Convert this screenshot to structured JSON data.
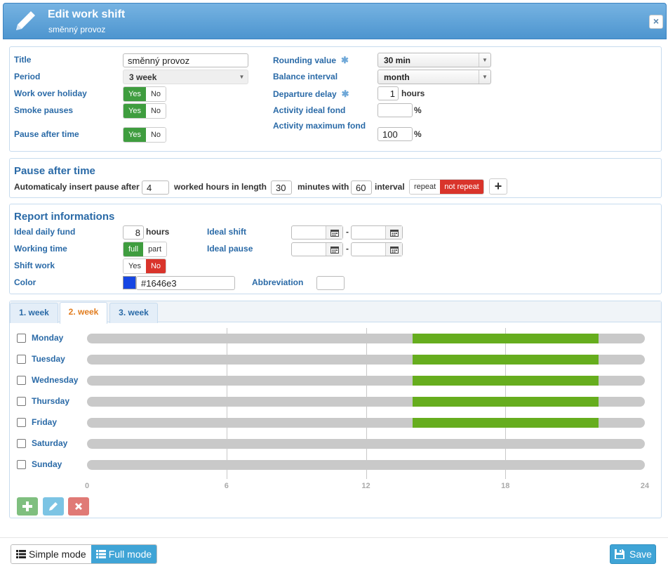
{
  "header": {
    "title": "Edit work shift",
    "subtitle": "směnný provoz",
    "close_label": "×"
  },
  "general": {
    "title_label": "Title",
    "title_value": "směnný provoz",
    "period_label": "Period",
    "period_value": "3 week",
    "holiday_label": "Work over holiday",
    "smoke_label": "Smoke pauses",
    "pause_after_time_label": "Pause after time",
    "yes": "Yes",
    "no": "No",
    "rounding_label": "Rounding value",
    "rounding_value": "30 min",
    "balance_label": "Balance interval",
    "balance_value": "month",
    "departure_label": "Departure delay",
    "departure_value": "1",
    "departure_unit": "hours",
    "ideal_fond_label": "Activity ideal fond",
    "ideal_fond_value": "",
    "max_fond_label": "Activity maximum fond",
    "max_fond_value": "100",
    "percent": "%"
  },
  "pause": {
    "title": "Pause after time",
    "text1": "Automaticaly insert pause after",
    "hours_value": "4",
    "text2": "worked hours in length",
    "minutes_value": "30",
    "text3": "minutes with",
    "interval_value": "60",
    "text4": "interval",
    "repeat": "repeat",
    "not_repeat": "not repeat",
    "add": "+"
  },
  "report": {
    "title": "Report informations",
    "daily_fund_label": "Ideal daily fund",
    "daily_fund_value": "8",
    "daily_fund_unit": "hours",
    "working_time_label": "Working time",
    "full": "full",
    "part": "part",
    "shift_work_label": "Shift work",
    "yes": "Yes",
    "no": "No",
    "color_label": "Color",
    "color_value": "#1646e3",
    "ideal_shift_label": "Ideal shift",
    "ideal_pause_label": "Ideal pause",
    "dash": "-",
    "abbreviation_label": "Abbreviation",
    "abbreviation_value": ""
  },
  "tabs": [
    {
      "label": "1. week"
    },
    {
      "label": "2. week"
    },
    {
      "label": "3. week"
    }
  ],
  "active_tab": 1,
  "schedule": {
    "days": [
      {
        "name": "Monday",
        "start": 14,
        "end": 22
      },
      {
        "name": "Tuesday",
        "start": 14,
        "end": 22
      },
      {
        "name": "Wednesday",
        "start": 14,
        "end": 22
      },
      {
        "name": "Thursday",
        "start": 14,
        "end": 22
      },
      {
        "name": "Friday",
        "start": 14,
        "end": 22
      },
      {
        "name": "Saturday",
        "start": null,
        "end": null
      },
      {
        "name": "Sunday",
        "start": null,
        "end": null
      }
    ],
    "ticks": [
      "0",
      "6",
      "12",
      "18",
      "24"
    ],
    "bar_color": "#66ad1e"
  },
  "footer": {
    "simple_mode": "Simple mode",
    "full_mode": "Full mode",
    "save": "Save"
  }
}
